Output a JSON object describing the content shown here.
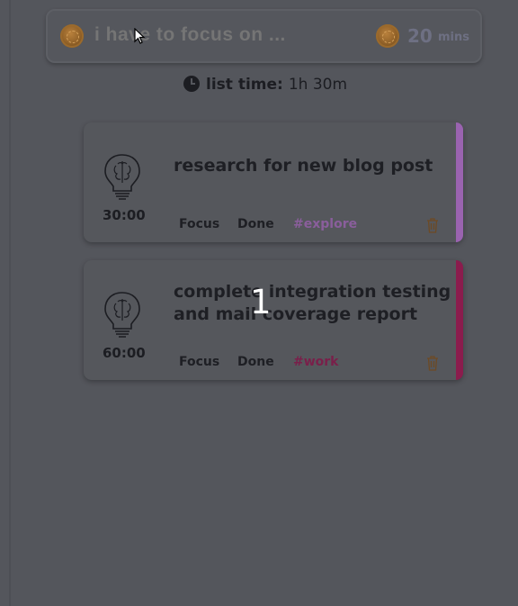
{
  "input": {
    "placeholder": "i have to focus on ...",
    "minutes": "20",
    "minutes_unit": "mins"
  },
  "list_time": {
    "label": "list time:",
    "value": "1h 30m"
  },
  "tasks": [
    {
      "title": "research for new blog post",
      "timer": "30:00",
      "focus_label": "Focus",
      "done_label": "Done",
      "tag": "#explore",
      "tag_color": "#8a5e9c",
      "stripe_color": "#9a63b0"
    },
    {
      "title": "complete integration testing and mail coverage report",
      "timer": "60:00",
      "focus_label": "Focus",
      "done_label": "Done",
      "tag": "#work",
      "tag_color": "#7a1f4a",
      "stripe_color": "#8b1c4d"
    }
  ],
  "overlay_counter": "1",
  "icons": {
    "input_left": "coin-icon",
    "input_right": "coin-icon",
    "list_time": "clock-icon",
    "task": "brain-bulb-icon",
    "delete": "trash-icon"
  },
  "colors": {
    "background": "#54565c",
    "muted_text": "#6e7083",
    "dark_text": "#1e1f24"
  }
}
